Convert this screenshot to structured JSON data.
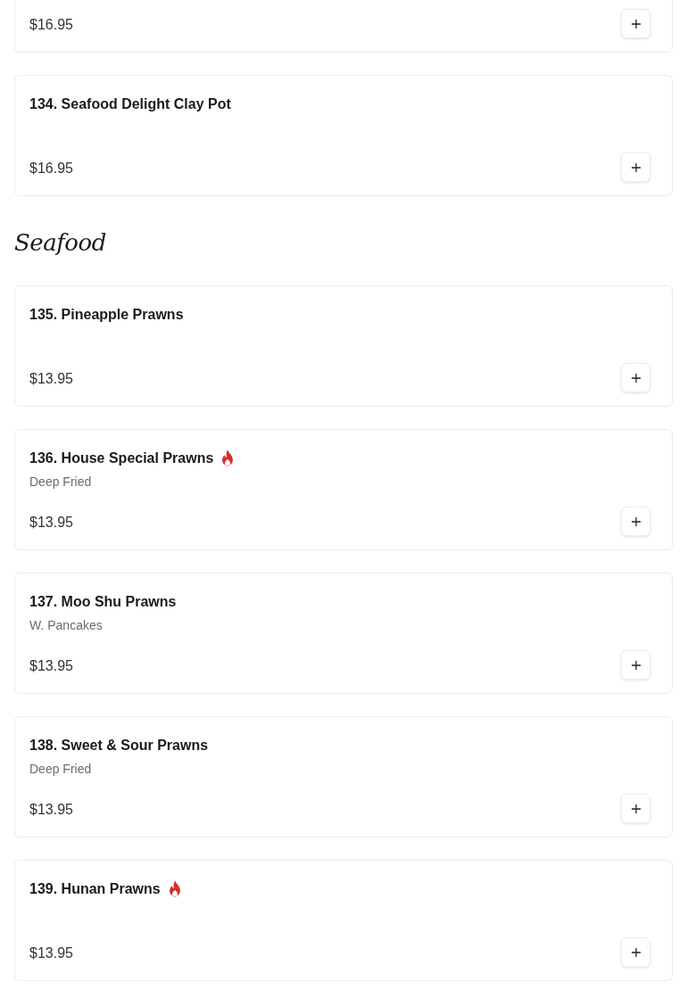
{
  "sections": [
    {
      "items": [
        {
          "price": "$16.95"
        },
        {
          "name": "134. Seafood Delight Clay Pot",
          "spicy": false,
          "price": "$16.95"
        }
      ]
    },
    {
      "title": "Seafood",
      "items": [
        {
          "name": "135. Pineapple Prawns",
          "spicy": false,
          "price": "$13.95"
        },
        {
          "name": "136. House Special Prawns",
          "spicy": true,
          "description": "Deep Fried",
          "price": "$13.95"
        },
        {
          "name": "137. Moo Shu Prawns",
          "spicy": false,
          "description": "W. Pancakes",
          "price": "$13.95"
        },
        {
          "name": "138. Sweet & Sour Prawns",
          "spicy": false,
          "description": "Deep Fried",
          "price": "$13.95"
        },
        {
          "name": "139. Hunan Prawns",
          "spicy": true,
          "price": "$13.95"
        }
      ]
    }
  ]
}
